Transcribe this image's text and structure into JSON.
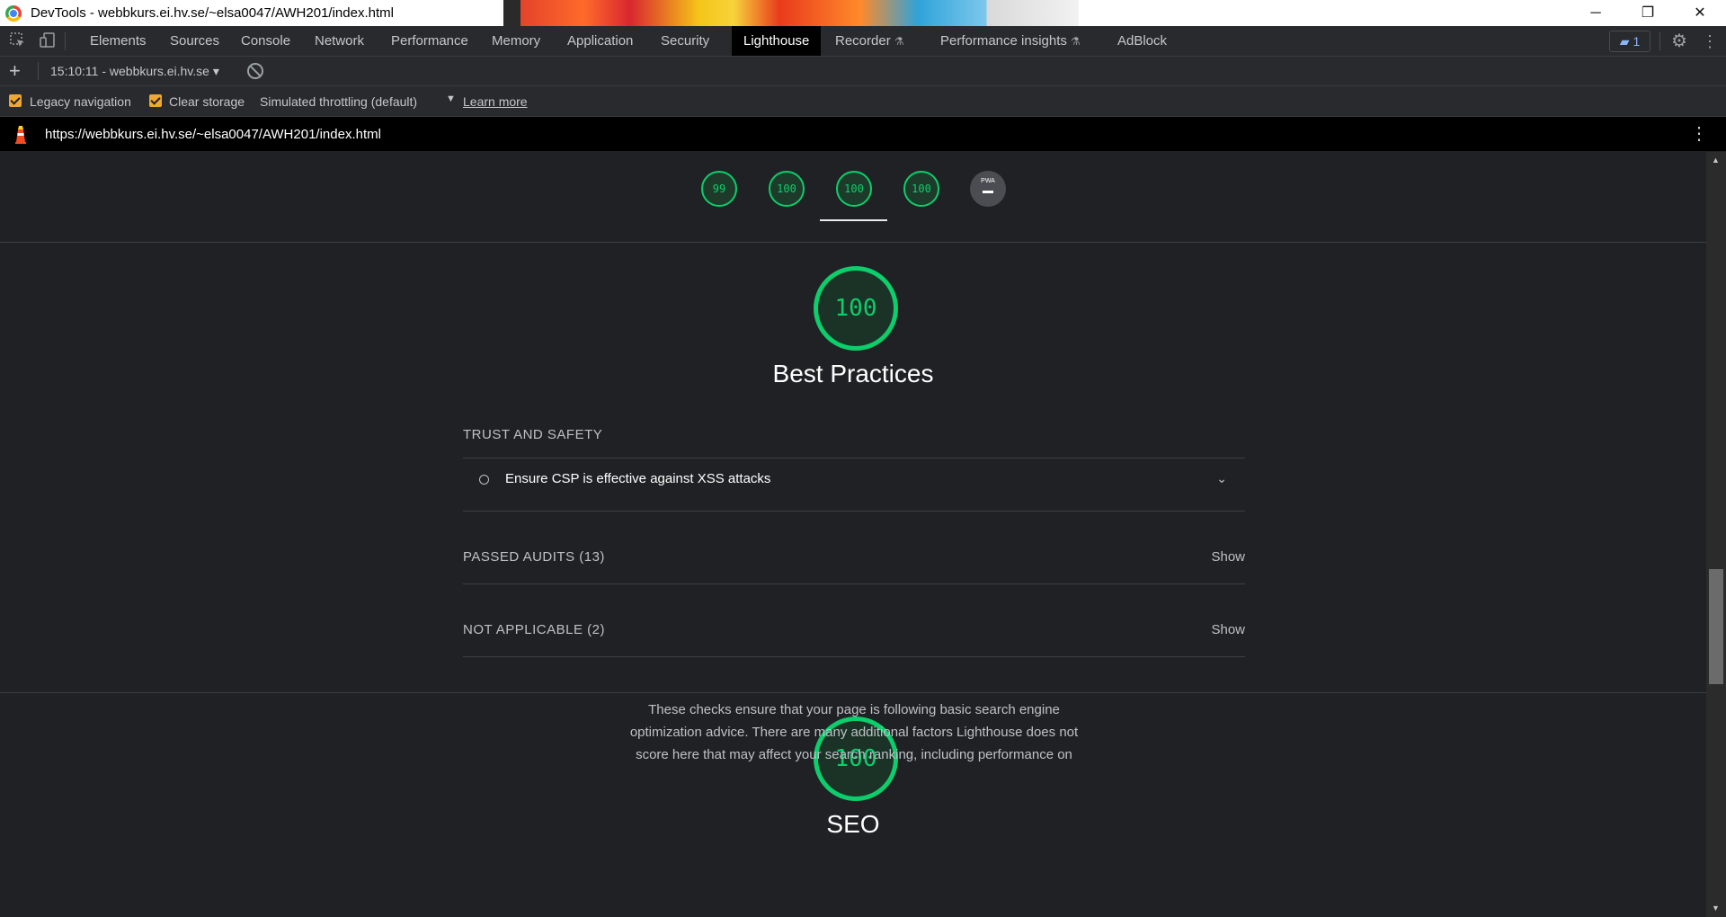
{
  "window": {
    "title": "DevTools - webbkurs.ei.hv.se/~elsa0047/AWH201/index.html",
    "controls": {
      "minimize": "─",
      "restore": "❐",
      "close": "✕"
    }
  },
  "devtools": {
    "tabs": [
      {
        "label": "Elements"
      },
      {
        "label": "Sources"
      },
      {
        "label": "Console"
      },
      {
        "label": "Network"
      },
      {
        "label": "Performance"
      },
      {
        "label": "Memory"
      },
      {
        "label": "Application"
      },
      {
        "label": "Security"
      },
      {
        "label": "Lighthouse",
        "active": true
      },
      {
        "label": "Recorder"
      },
      {
        "label": "Performance insights"
      },
      {
        "label": "AdBlock"
      }
    ],
    "issues_count": "1"
  },
  "lighthouse": {
    "report_selector": "15:10:11 - webbkurs.ei.hv.se",
    "options": {
      "legacy_navigation": "Legacy navigation",
      "clear_storage": "Clear storage",
      "throttling": "Simulated throttling (default)",
      "learn_more": "Learn more"
    },
    "url": "https://webbkurs.ei.hv.se/~elsa0047/AWH201/index.html",
    "score_gauges": [
      "99",
      "100",
      "100",
      "100"
    ],
    "pwa_label": "PWA",
    "best_practices": {
      "score": "100",
      "title": "Best Practices",
      "group_title": "TRUST AND SAFETY",
      "audit_label": "Ensure CSP is effective against XSS attacks",
      "passed_audits": "PASSED AUDITS (13)",
      "not_applicable": "NOT APPLICABLE (2)",
      "show_label": "Show"
    },
    "seo": {
      "score": "100",
      "title": "SEO",
      "description": "These checks ensure that your page is following basic search engine optimization advice. There are many additional factors Lighthouse does not score here that may affect your search ranking, including performance on"
    }
  },
  "colors": {
    "pass_green": "#0cce6b",
    "checkbox_orange": "#f0a732",
    "background": "#202124"
  }
}
